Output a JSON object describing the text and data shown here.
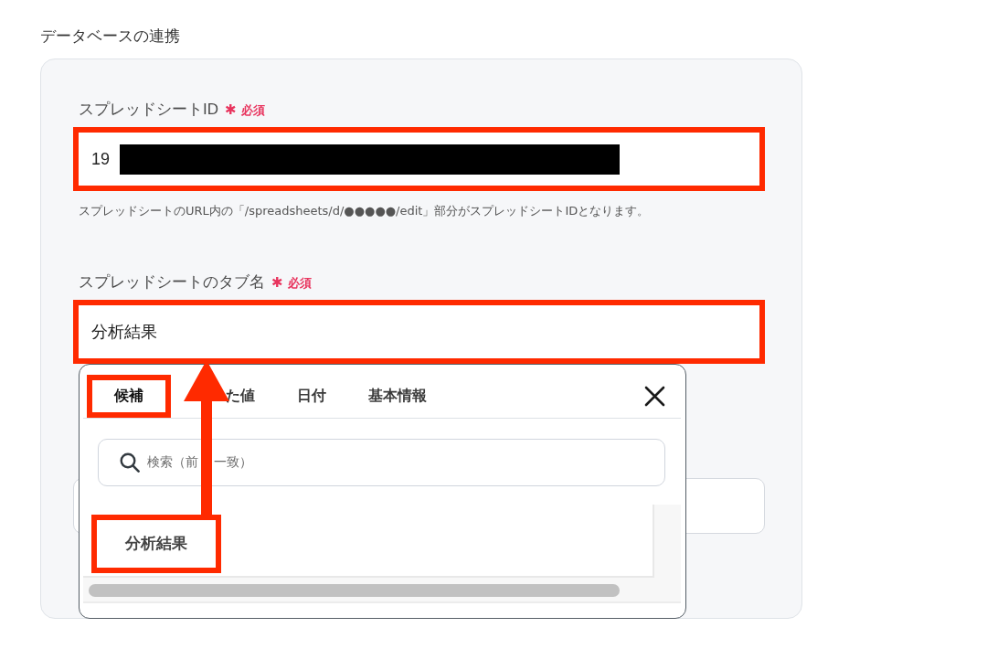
{
  "section_title": "データベースの連携",
  "fields": [
    {
      "label": "スプレッドシートID",
      "required_mark": "✱",
      "required_text": "必須",
      "value": "19",
      "redacted": true,
      "highlighted": true,
      "help": "スプレッドシートのURL内の「/spreadsheets/d/●●●●●/edit」部分がスプレッドシートIDとなります。"
    },
    {
      "label": "スプレッドシートのタブ名",
      "required_mark": "✱",
      "required_text": "必須",
      "value": "分析結果",
      "highlighted": true,
      "picker": {
        "tabs": [
          {
            "label": "候補",
            "selected": true,
            "highlighted": true
          },
          {
            "label": "た値",
            "selected": false,
            "highlighted": false
          },
          {
            "label": "日付",
            "selected": false,
            "highlighted": false
          },
          {
            "label": "基本情報",
            "selected": false,
            "highlighted": false
          }
        ],
        "search": {
          "placeholder": [
            "検索（前",
            "一致）"
          ]
        },
        "items": [
          {
            "label": "分析結果",
            "highlighted": true
          }
        ]
      }
    },
    {
      "highlighted": false
    }
  ]
}
